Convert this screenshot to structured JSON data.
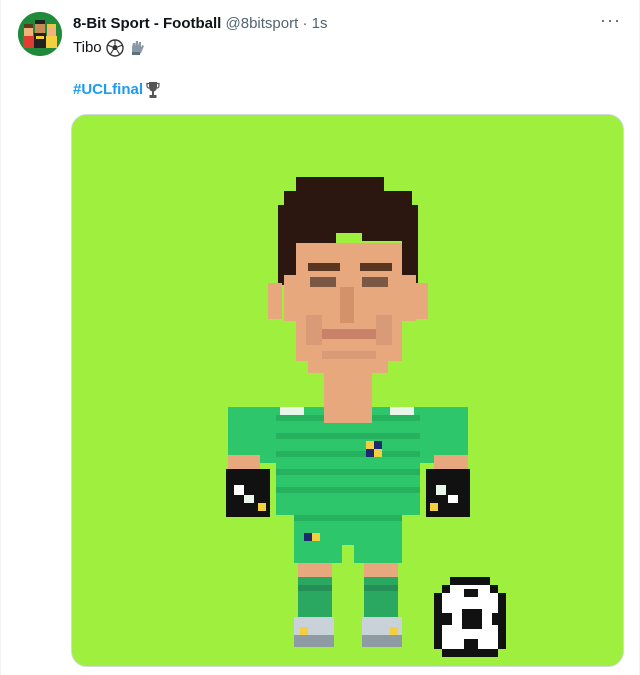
{
  "tweet": {
    "author_name": "8-Bit Sport - Football",
    "handle": "@8bitsport",
    "separator": "·",
    "time": "1s",
    "more_label": "···",
    "text": "Tibo",
    "text_emojis": [
      "soccer-ball-icon",
      "gloves-icon"
    ],
    "hashtag": "#UCLfinal",
    "hashtag_emoji": "trophy-icon"
  },
  "media": {
    "subject": "pixel-art goalkeeper",
    "background_color": "#9fef3f",
    "kit_color": "#2dc66b"
  },
  "colors": {
    "link": "#1d9bf0",
    "secondary_text": "#536471",
    "primary_text": "#0f1419"
  }
}
